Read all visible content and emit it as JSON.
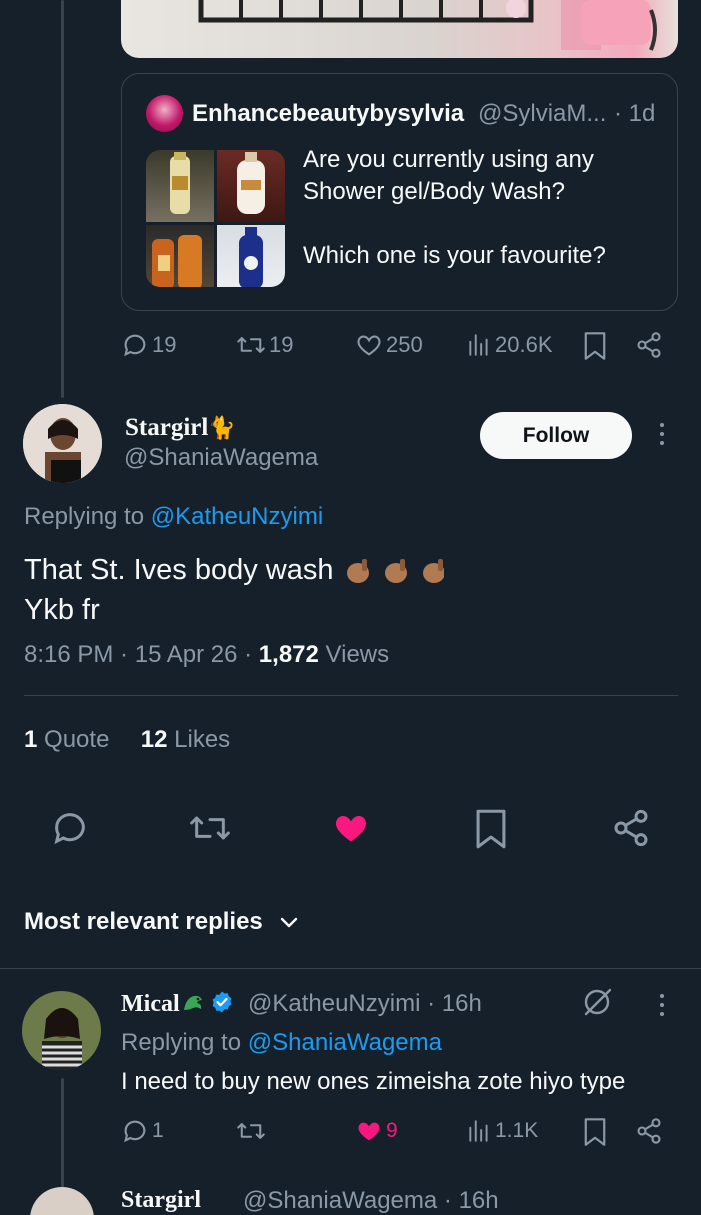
{
  "quoted_tweet": {
    "author_name": "Enhancebeautybysylvia",
    "handle": "@SylviaM...",
    "time": "· 1d",
    "text_line1": "Are you currently using any",
    "text_line2": "Shower gel/Body Wash?",
    "text_line3": "Which one is your favourite?"
  },
  "parent_metrics": {
    "replies": "19",
    "retweets": "19",
    "likes": "250",
    "views": "20.6K"
  },
  "main_tweet": {
    "author_name": "Stargirl",
    "author_emoji": "🐈",
    "handle": "@ShaniaWagema",
    "follow_label": "Follow",
    "replying_prefix": "Replying to",
    "replying_to": "@KatheuNzyimi",
    "text_line1": "That St. Ives body wash",
    "text_line2": "Ykb fr",
    "time": "8:16 PM",
    "date": "15 Apr 26",
    "views_count": "1,872",
    "views_label": "Views",
    "quotes_count": "1",
    "quotes_label": "Quote",
    "likes_count": "12",
    "likes_label": "Likes",
    "liked": true,
    "accent_like_color": "#f91880"
  },
  "replies_header": {
    "label": "Most relevant replies"
  },
  "reply": {
    "author_name": "Mical",
    "handle": "@KatheuNzyimi",
    "time": "· 16h",
    "verified": true,
    "replying_prefix": "Replying to",
    "replying_to": "@ShaniaWagema",
    "text": "I need to buy new ones zimeisha zote hiyo type",
    "replies": "1",
    "likes": "9",
    "views": "1.1K",
    "liked": true
  },
  "next_reply": {
    "author_name": "Stargirl",
    "handle": "@ShaniaWagema",
    "time": "· 16h"
  },
  "colors": {
    "background": "#15202b",
    "text": "#f7f9f9",
    "muted": "#8b98a5",
    "link": "#1d9bf0",
    "like": "#f91880",
    "border": "#38444d"
  }
}
